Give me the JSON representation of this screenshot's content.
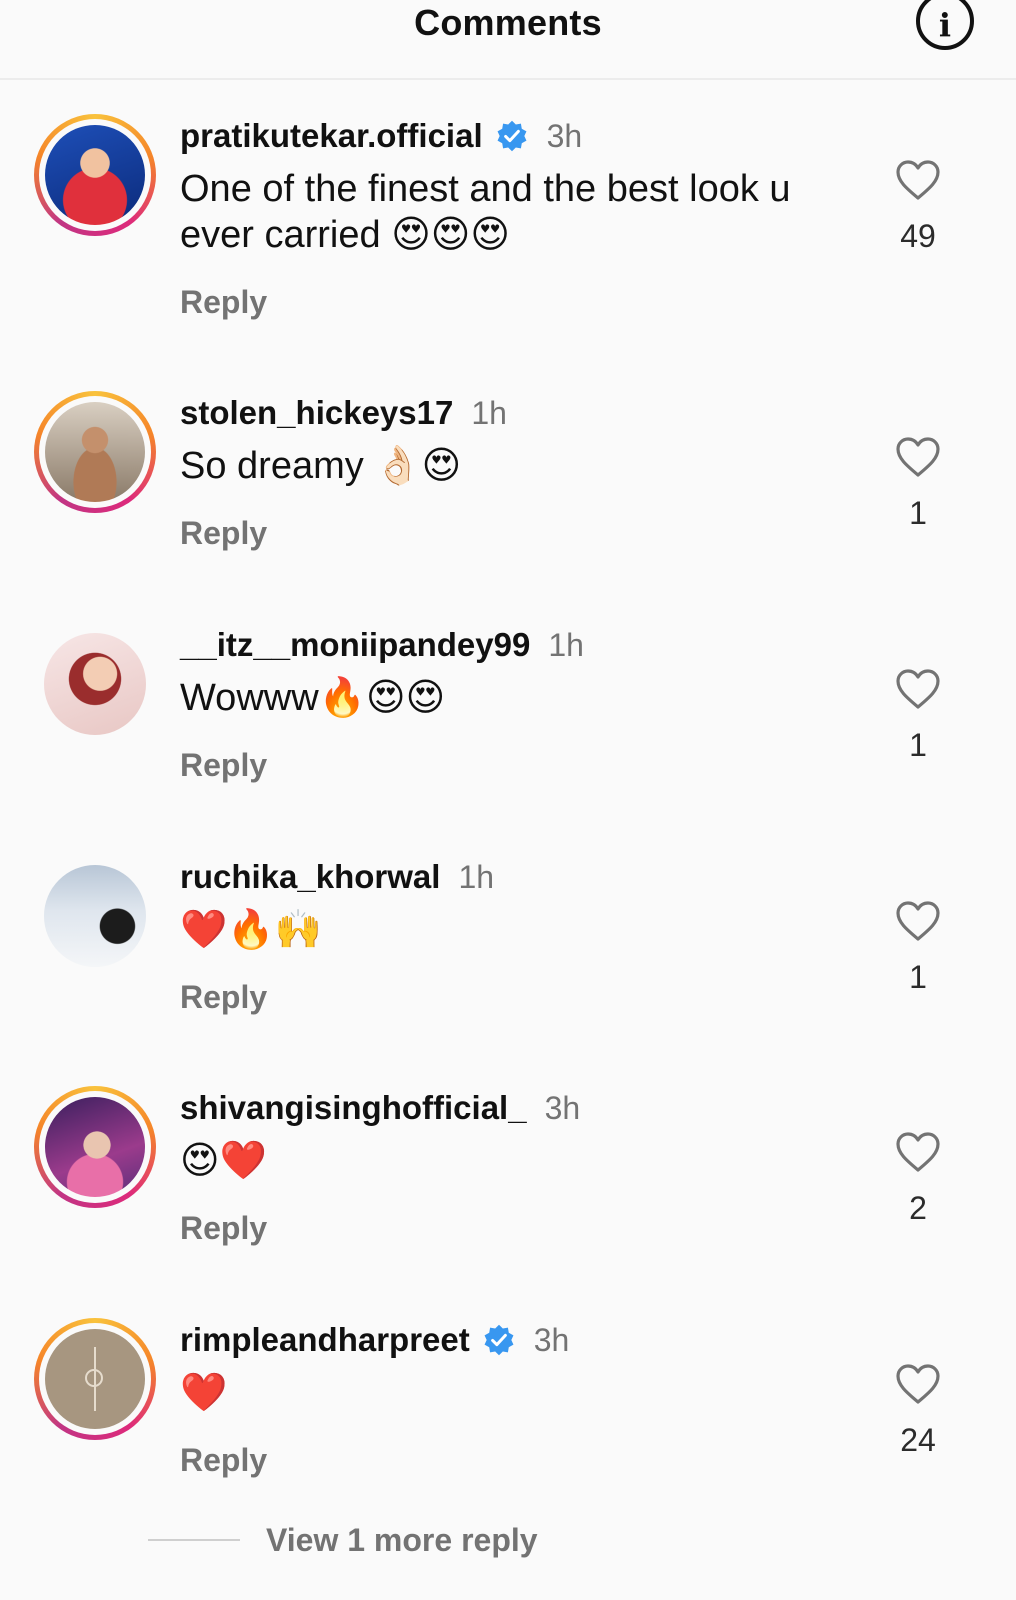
{
  "header": {
    "title": "Comments",
    "info_icon": "info-icon"
  },
  "comments": [
    {
      "username": "pratikutekar.official",
      "verified": true,
      "time": "3h",
      "text": "One of the finest and the best look u ever carried 😍😍😍",
      "reply_label": "Reply",
      "likes": "49",
      "story_ring": true
    },
    {
      "username": "stolen_hickeys17",
      "verified": false,
      "time": "1h",
      "text": "So dreamy 👌🏻😍",
      "reply_label": "Reply",
      "likes": "1",
      "story_ring": true
    },
    {
      "username": "__itz__moniipandey99",
      "verified": false,
      "time": "1h",
      "text": "Wowww🔥😍😍",
      "reply_label": "Reply",
      "likes": "1",
      "story_ring": false
    },
    {
      "username": "ruchika_khorwal",
      "verified": false,
      "time": "1h",
      "text": "❤️🔥🙌",
      "reply_label": "Reply",
      "likes": "1",
      "story_ring": false
    },
    {
      "username": "shivangisinghofficial_",
      "verified": false,
      "time": "3h",
      "text": "😍❤️",
      "reply_label": "Reply",
      "likes": "2",
      "story_ring": true
    },
    {
      "username": "rimpleandharpreet",
      "verified": true,
      "time": "3h",
      "text": "❤️",
      "reply_label": "Reply",
      "likes": "24",
      "story_ring": true
    }
  ],
  "view_more_replies": "View 1 more reply",
  "colors": {
    "verified_badge": "#3897f0",
    "secondary_text": "#737373",
    "story_ring": [
      "#f9c23c",
      "#f58529",
      "#dd2a7b",
      "#c13584"
    ]
  }
}
